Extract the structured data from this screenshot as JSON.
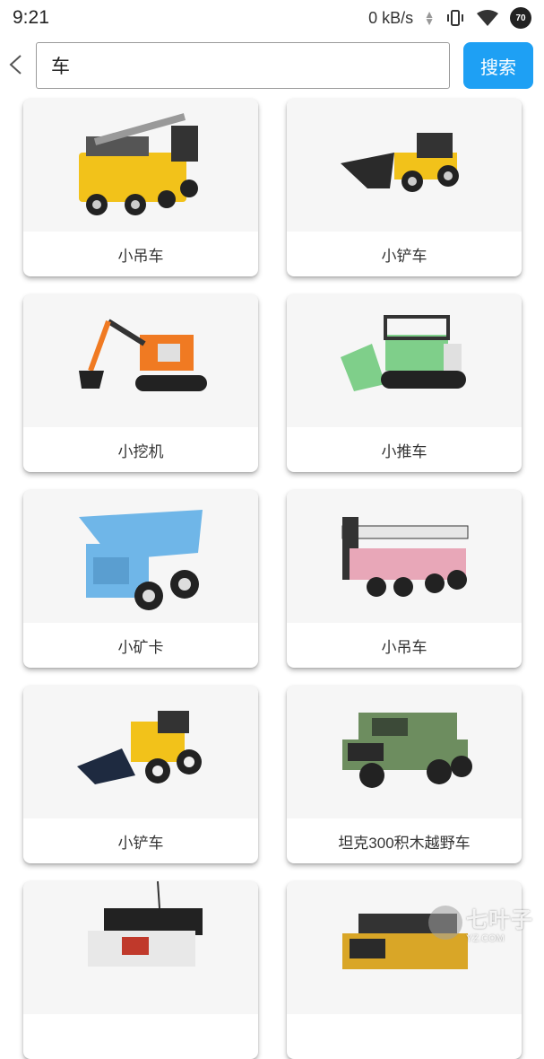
{
  "status_bar": {
    "time": "9:21",
    "network_speed": "0 kB/s",
    "battery": "70",
    "icons": [
      "data-arrows-icon",
      "vibrate-icon",
      "wifi-icon",
      "battery-icon"
    ]
  },
  "search": {
    "value": "车",
    "button_label": "搜索",
    "back_icon": "chevron-left-icon"
  },
  "results": [
    {
      "label": "小吊车",
      "image": "crane-truck-yellow",
      "color": "#f2c21a"
    },
    {
      "label": "小铲车",
      "image": "wheel-loader-yellow",
      "color": "#f2c21a"
    },
    {
      "label": "小挖机",
      "image": "excavator-orange",
      "color": "#f07a22"
    },
    {
      "label": "小推车",
      "image": "bulldozer-green",
      "color": "#7fcf8a"
    },
    {
      "label": "小矿卡",
      "image": "mining-truck-blue",
      "color": "#6fb6e8"
    },
    {
      "label": "小吊车",
      "image": "crane-truck-pink",
      "color": "#e8a7b8"
    },
    {
      "label": "小铲车",
      "image": "wheel-loader-yellow-2",
      "color": "#f2c21a"
    },
    {
      "label": "坦克300积木越野车",
      "image": "offroad-suv-green",
      "color": "#6d8d5f"
    },
    {
      "label": "",
      "image": "offroad-buggy-white",
      "color": "#e8e8e8"
    },
    {
      "label": "",
      "image": "offroad-buggy-yellow",
      "color": "#d9a627"
    }
  ],
  "watermark": {
    "big": "七叶子",
    "small": "YZ.COM"
  }
}
